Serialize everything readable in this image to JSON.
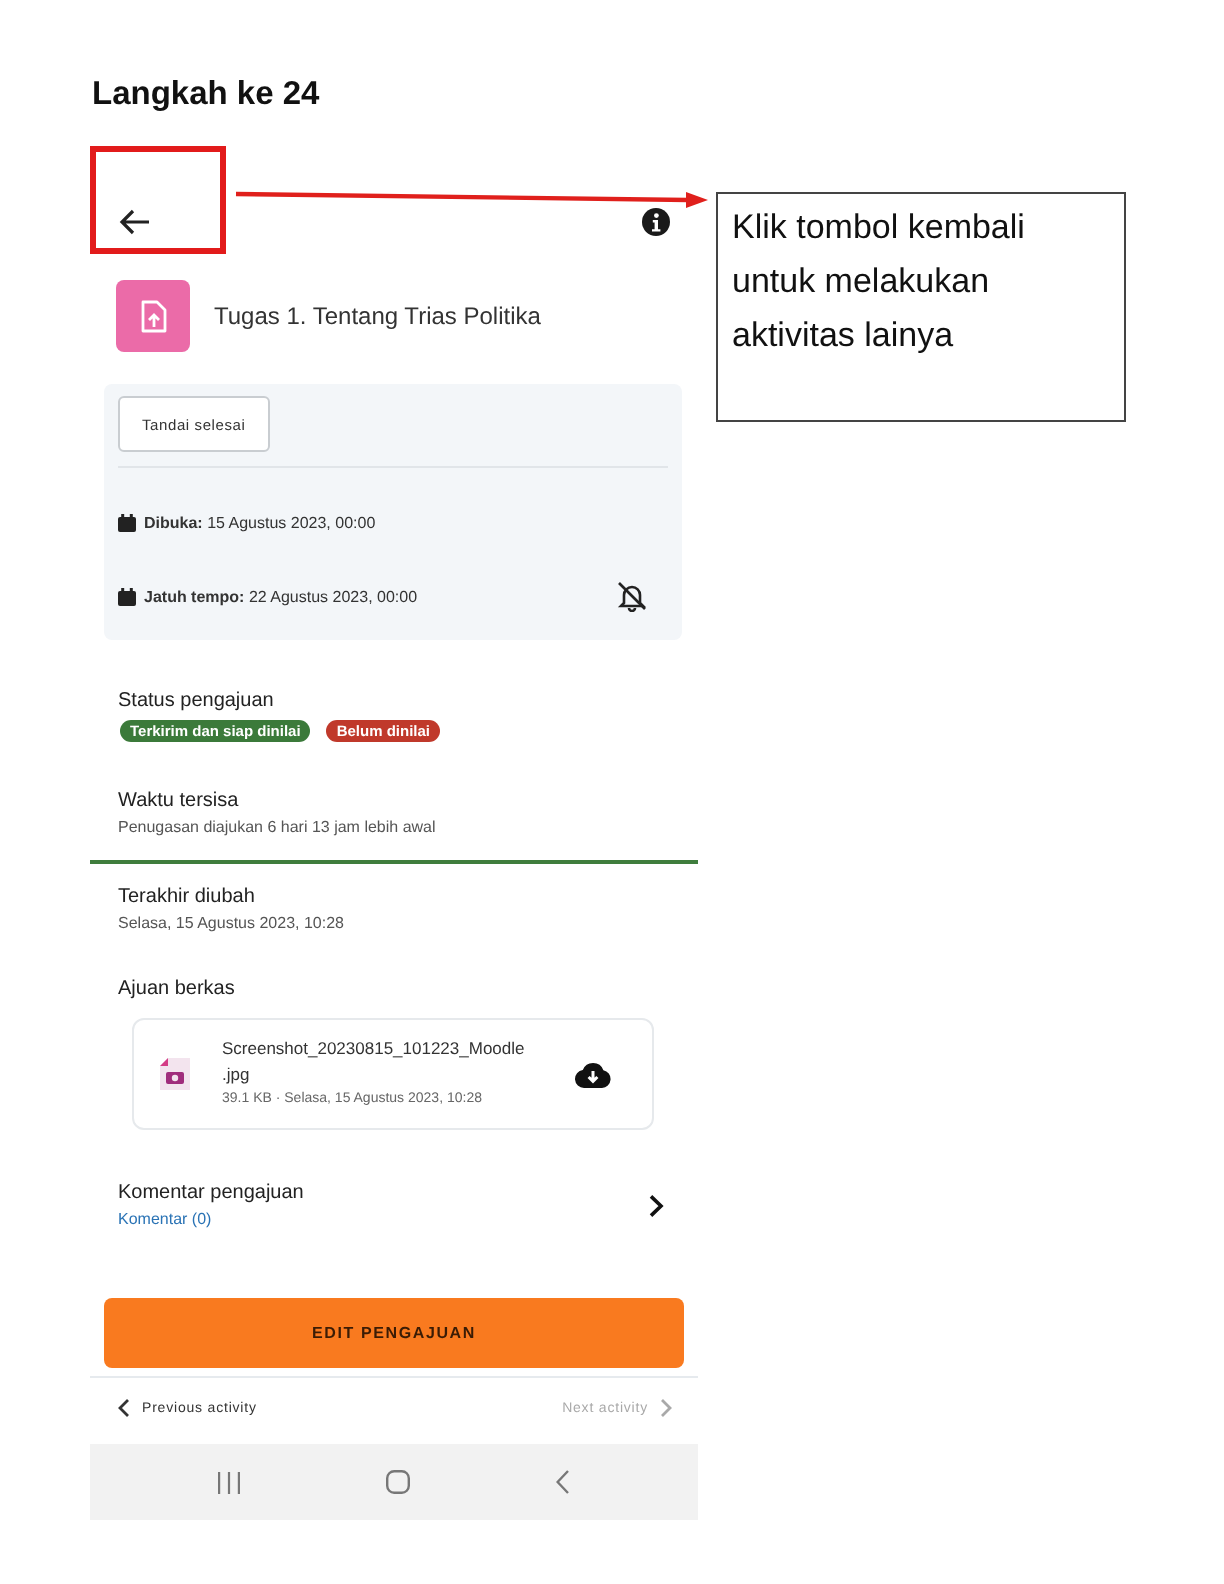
{
  "heading": "Langkah ke 24",
  "annotation": {
    "lines": [
      "Klik tombol kembali",
      "untuk melakukan",
      "aktivitas lainya"
    ]
  },
  "app_bar": {
    "back_highlighted": true
  },
  "assignment": {
    "title": "Tugas 1. Tentang Trias Politika"
  },
  "mark_done_button": "Tandai selesai",
  "dates": [
    {
      "kind": "opened",
      "text": "**Dibuka:** 15 Agustus 2023, 00:00"
    },
    {
      "kind": "due",
      "text": "**Jatuh tempo:** 22 Agustus 2023, 00:00"
    }
  ],
  "status": {
    "label": "Status pengajuan",
    "badges": [
      {
        "text": "Terkirim dan siap dinilai",
        "color": "#3b7a3a"
      },
      {
        "text": "Belum dinilai",
        "color": "#c0392b"
      }
    ]
  },
  "time_left": {
    "label": "Waktu tersisa",
    "value": "Penugasan diajukan 6 hari 13 jam lebih awal"
  },
  "last_modified": {
    "label": "Terakhir diubah",
    "value": "Selasa, 15 Agustus 2023, 10:28"
  },
  "file_submissions": {
    "label": "Ajuan berkas",
    "files": [
      {
        "name": "Screenshot_20230815_101223_Moodle.jpg",
        "meta": "39.1 KB · Selasa, 15 Agustus 2023, 10:28"
      }
    ]
  },
  "comments": {
    "label": "Komentar pengajuan",
    "link": "Komentar (0)"
  },
  "edit_button": "EDIT PENGAJUAN",
  "activity_nav": {
    "previous": {
      "label": "Previous activity",
      "disabled": false
    },
    "next": {
      "label": "Next activity",
      "disabled": true
    }
  }
}
